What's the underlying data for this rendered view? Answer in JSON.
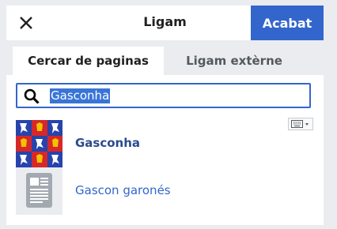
{
  "dialog": {
    "title": "Ligam",
    "done_label": "Acabat",
    "close_icon": "close-icon"
  },
  "tabs": [
    {
      "label": "Cercar de paginas",
      "active": true
    },
    {
      "label": "Ligam extèrne",
      "active": false
    }
  ],
  "search": {
    "value": "Gasconha",
    "icon": "search-icon",
    "keyboard_icon": "keyboard-icon"
  },
  "results": [
    {
      "label": "Gasconha",
      "thumbnail": "gascony-flag-image",
      "bold": true
    },
    {
      "label": "Gascon garonés",
      "thumbnail": "article-placeholder-icon",
      "bold": false
    }
  ],
  "colors": {
    "accent": "#3366cc",
    "flag_red": "#d6272a",
    "flag_blue": "#2743ac",
    "flag_gold": "#f2c200"
  }
}
